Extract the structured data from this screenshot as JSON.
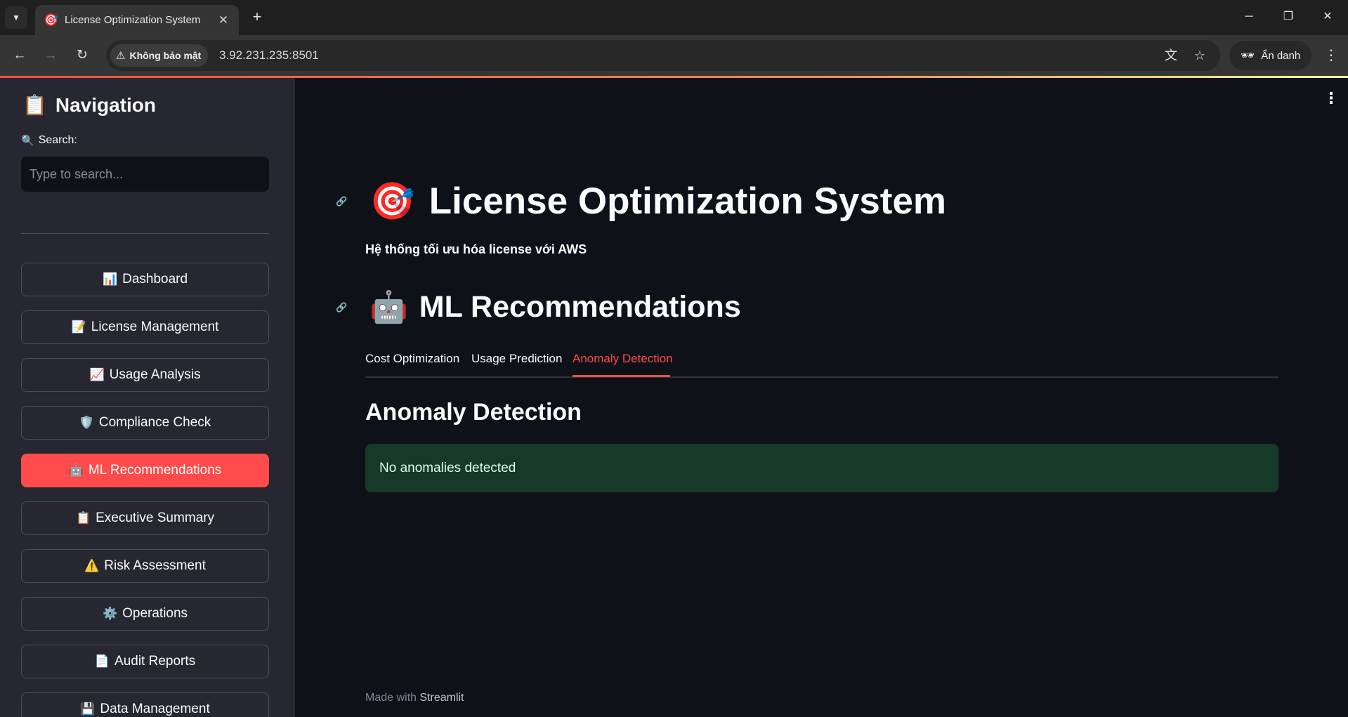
{
  "browser": {
    "tab_title": "License Optimization System",
    "tab_favicon": "🎯",
    "security_label": "Không bảo mật",
    "url": "3.92.231.235:8501",
    "incognito_label": "Ẩn danh"
  },
  "sidebar": {
    "title_icon": "📋",
    "title": "Navigation",
    "search_icon": "🔍",
    "search_label": "Search:",
    "search_placeholder": "Type to search...",
    "items": [
      {
        "icon": "📊",
        "label": "Dashboard",
        "active": false
      },
      {
        "icon": "📝",
        "label": "License Management",
        "active": false
      },
      {
        "icon": "📈",
        "label": "Usage Analysis",
        "active": false
      },
      {
        "icon": "🛡️",
        "label": "Compliance Check",
        "active": false
      },
      {
        "icon": "🤖",
        "label": "ML Recommendations",
        "active": true
      },
      {
        "icon": "📋",
        "label": "Executive Summary",
        "active": false
      },
      {
        "icon": "⚠️",
        "label": "Risk Assessment",
        "active": false
      },
      {
        "icon": "⚙️",
        "label": "Operations",
        "active": false
      },
      {
        "icon": "📄",
        "label": "Audit Reports",
        "active": false
      },
      {
        "icon": "💾",
        "label": "Data Management",
        "active": false
      }
    ]
  },
  "main": {
    "title_icon": "🎯",
    "title": "License Optimization System",
    "subtitle": "Hệ thống tối ưu hóa license với AWS",
    "section_icon": "🤖",
    "section_title": "ML Recommendations",
    "tabs": [
      {
        "label": "Cost Optimization",
        "active": false
      },
      {
        "label": "Usage Prediction",
        "active": false
      },
      {
        "label": "Anomaly Detection",
        "active": true
      }
    ],
    "panel_title": "Anomaly Detection",
    "alert_text": "No anomalies detected",
    "footer_prefix": "Made with",
    "footer_brand": "Streamlit"
  },
  "colors": {
    "primary": "#ff4b4b",
    "background": "#0e1117",
    "sidebar_bg": "#262730",
    "success_bg": "#173928"
  }
}
